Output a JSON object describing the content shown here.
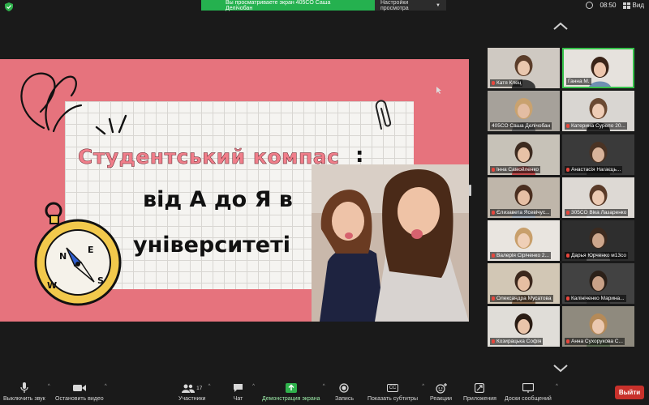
{
  "topbar": {
    "share_banner": "Вы просматриваете экран 405CO Саша Делічобан",
    "view_options": "Настройки просмотра",
    "time": "08:50",
    "view_label": "Вид"
  },
  "slide": {
    "title": "Студентський компас",
    "colon": ":",
    "line2": "від А до Я в",
    "line3": "університеті",
    "colors": {
      "background": "#e6737d",
      "title": "#f07e8a",
      "paper": "#f5f4f1"
    }
  },
  "participants": [
    {
      "name": "Катя Клец",
      "muted": true
    },
    {
      "name": "Ганна М.",
      "muted": false,
      "active": true
    },
    {
      "name": "405CO Саша Делічобан",
      "muted": false
    },
    {
      "name": "Катерина Сурело 20...",
      "muted": true
    },
    {
      "name": "Інна Самойленко",
      "muted": true
    },
    {
      "name": "Анастасія Нагаєць...",
      "muted": true
    },
    {
      "name": "Єлизавета Ясевічус...",
      "muted": true
    },
    {
      "name": "305CO Віка Лазаренко",
      "muted": true
    },
    {
      "name": "Валерія Сіріченко 2...",
      "muted": true
    },
    {
      "name": "Дарья Юрченко м13со",
      "muted": true
    },
    {
      "name": "Олександра Мусатова",
      "muted": true
    },
    {
      "name": "Калініченко Марина...",
      "muted": true
    },
    {
      "name": "Козирацька Софія",
      "muted": true
    },
    {
      "name": "Анна Сухорукова С...",
      "muted": true
    }
  ],
  "toolbar": {
    "unmute": "Выключить звук",
    "stop_video": "Остановить видео",
    "participants": "Участники",
    "participants_count": "17",
    "chat": "Чат",
    "share_screen": "Демонстрация экрана",
    "record": "Запись",
    "captions": "Показать субтитры",
    "reactions": "Реакции",
    "apps": "Приложения",
    "whiteboards": "Доски сообщений",
    "leave": "Выйти",
    "captions_icon_text": "CC"
  }
}
